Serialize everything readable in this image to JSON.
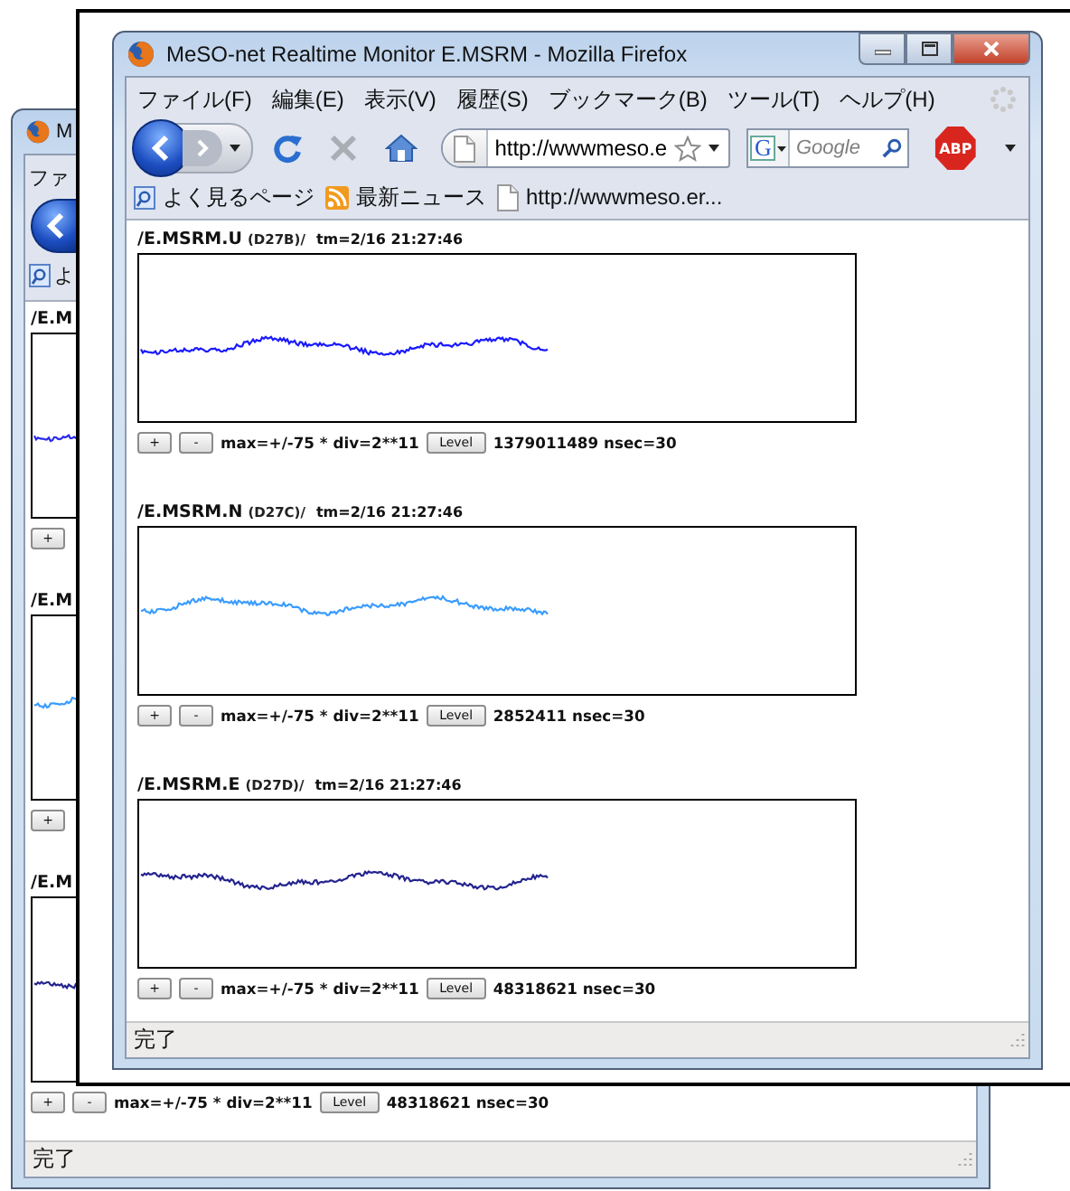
{
  "back_window": {
    "title": "M",
    "menu": [
      "ファ"
    ],
    "bookmarks": [
      "よ"
    ],
    "panels": [
      {
        "heading": "/E.M",
        "color": "#2a2af0",
        "buttons": [
          "+"
        ]
      },
      {
        "heading": "/E.M",
        "color": "#3a9cff",
        "buttons": [
          "+"
        ]
      },
      {
        "heading": "/E.M",
        "color": "#24248f",
        "buttons": [
          "+",
          "-"
        ],
        "scale": "max=+/-75 * div=2**11",
        "level_button": "Level",
        "reading": "48318621 nsec=30"
      }
    ],
    "status": "完了"
  },
  "window": {
    "title": "MeSO-net Realtime Monitor E.MSRM - Mozilla Firefox",
    "menu": [
      "ファイル(F)",
      "編集(E)",
      "表示(V)",
      "履歴(S)",
      "ブックマーク(B)",
      "ツール(T)",
      "ヘルプ(H)"
    ],
    "address": "http://wwwmeso.e",
    "search": {
      "engine": "G",
      "placeholder": "Google"
    },
    "abp_label": "ABP",
    "bookmarks": [
      "よく見るページ",
      "最新ニュース",
      "http://wwwmeso.er..."
    ],
    "panels": [
      {
        "station": "/E.MSRM.U",
        "code": "(D27B)/",
        "time": "tm=2/16 21:27:46",
        "color": "#1a1aff",
        "buttons": [
          "+",
          "-"
        ],
        "scale": "max=+/-75 * div=2**11",
        "level_button": "Level",
        "reading": "1379011489 nsec=30"
      },
      {
        "station": "/E.MSRM.N",
        "code": "(D27C)/",
        "time": "tm=2/16 21:27:46",
        "color": "#3a9cff",
        "buttons": [
          "+",
          "-"
        ],
        "scale": "max=+/-75 * div=2**11",
        "level_button": "Level",
        "reading": "2852411 nsec=30"
      },
      {
        "station": "/E.MSRM.E",
        "code": "(D27D)/",
        "time": "tm=2/16 21:27:46",
        "color": "#24248f",
        "buttons": [
          "+",
          "-"
        ],
        "scale": "max=+/-75 * div=2**11",
        "level_button": "Level",
        "reading": "48318621 nsec=30"
      }
    ],
    "status": "完了"
  }
}
